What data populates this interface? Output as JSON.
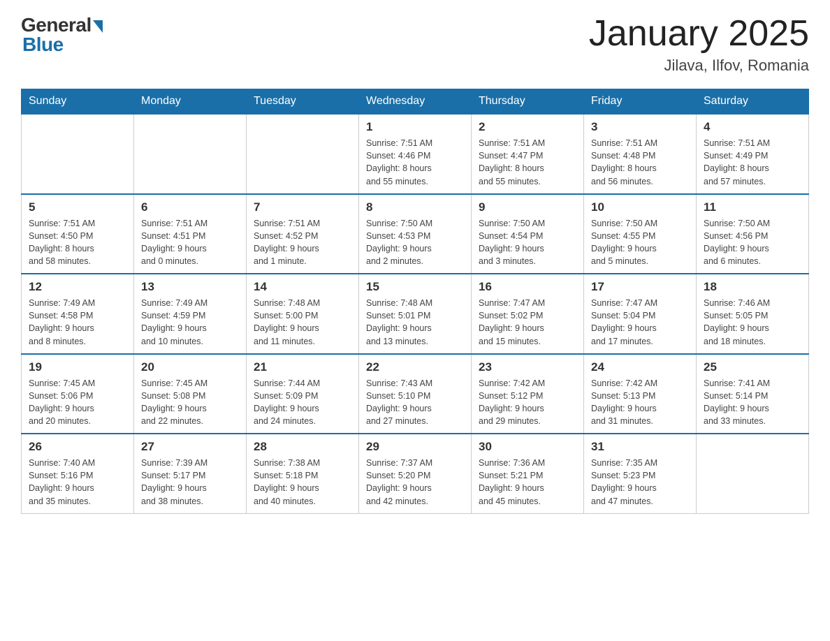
{
  "header": {
    "logo_general": "General",
    "logo_blue": "Blue",
    "title": "January 2025",
    "subtitle": "Jilava, Ilfov, Romania"
  },
  "days_of_week": [
    "Sunday",
    "Monday",
    "Tuesday",
    "Wednesday",
    "Thursday",
    "Friday",
    "Saturday"
  ],
  "weeks": [
    [
      {
        "day": "",
        "info": ""
      },
      {
        "day": "",
        "info": ""
      },
      {
        "day": "",
        "info": ""
      },
      {
        "day": "1",
        "info": "Sunrise: 7:51 AM\nSunset: 4:46 PM\nDaylight: 8 hours\nand 55 minutes."
      },
      {
        "day": "2",
        "info": "Sunrise: 7:51 AM\nSunset: 4:47 PM\nDaylight: 8 hours\nand 55 minutes."
      },
      {
        "day": "3",
        "info": "Sunrise: 7:51 AM\nSunset: 4:48 PM\nDaylight: 8 hours\nand 56 minutes."
      },
      {
        "day": "4",
        "info": "Sunrise: 7:51 AM\nSunset: 4:49 PM\nDaylight: 8 hours\nand 57 minutes."
      }
    ],
    [
      {
        "day": "5",
        "info": "Sunrise: 7:51 AM\nSunset: 4:50 PM\nDaylight: 8 hours\nand 58 minutes."
      },
      {
        "day": "6",
        "info": "Sunrise: 7:51 AM\nSunset: 4:51 PM\nDaylight: 9 hours\nand 0 minutes."
      },
      {
        "day": "7",
        "info": "Sunrise: 7:51 AM\nSunset: 4:52 PM\nDaylight: 9 hours\nand 1 minute."
      },
      {
        "day": "8",
        "info": "Sunrise: 7:50 AM\nSunset: 4:53 PM\nDaylight: 9 hours\nand 2 minutes."
      },
      {
        "day": "9",
        "info": "Sunrise: 7:50 AM\nSunset: 4:54 PM\nDaylight: 9 hours\nand 3 minutes."
      },
      {
        "day": "10",
        "info": "Sunrise: 7:50 AM\nSunset: 4:55 PM\nDaylight: 9 hours\nand 5 minutes."
      },
      {
        "day": "11",
        "info": "Sunrise: 7:50 AM\nSunset: 4:56 PM\nDaylight: 9 hours\nand 6 minutes."
      }
    ],
    [
      {
        "day": "12",
        "info": "Sunrise: 7:49 AM\nSunset: 4:58 PM\nDaylight: 9 hours\nand 8 minutes."
      },
      {
        "day": "13",
        "info": "Sunrise: 7:49 AM\nSunset: 4:59 PM\nDaylight: 9 hours\nand 10 minutes."
      },
      {
        "day": "14",
        "info": "Sunrise: 7:48 AM\nSunset: 5:00 PM\nDaylight: 9 hours\nand 11 minutes."
      },
      {
        "day": "15",
        "info": "Sunrise: 7:48 AM\nSunset: 5:01 PM\nDaylight: 9 hours\nand 13 minutes."
      },
      {
        "day": "16",
        "info": "Sunrise: 7:47 AM\nSunset: 5:02 PM\nDaylight: 9 hours\nand 15 minutes."
      },
      {
        "day": "17",
        "info": "Sunrise: 7:47 AM\nSunset: 5:04 PM\nDaylight: 9 hours\nand 17 minutes."
      },
      {
        "day": "18",
        "info": "Sunrise: 7:46 AM\nSunset: 5:05 PM\nDaylight: 9 hours\nand 18 minutes."
      }
    ],
    [
      {
        "day": "19",
        "info": "Sunrise: 7:45 AM\nSunset: 5:06 PM\nDaylight: 9 hours\nand 20 minutes."
      },
      {
        "day": "20",
        "info": "Sunrise: 7:45 AM\nSunset: 5:08 PM\nDaylight: 9 hours\nand 22 minutes."
      },
      {
        "day": "21",
        "info": "Sunrise: 7:44 AM\nSunset: 5:09 PM\nDaylight: 9 hours\nand 24 minutes."
      },
      {
        "day": "22",
        "info": "Sunrise: 7:43 AM\nSunset: 5:10 PM\nDaylight: 9 hours\nand 27 minutes."
      },
      {
        "day": "23",
        "info": "Sunrise: 7:42 AM\nSunset: 5:12 PM\nDaylight: 9 hours\nand 29 minutes."
      },
      {
        "day": "24",
        "info": "Sunrise: 7:42 AM\nSunset: 5:13 PM\nDaylight: 9 hours\nand 31 minutes."
      },
      {
        "day": "25",
        "info": "Sunrise: 7:41 AM\nSunset: 5:14 PM\nDaylight: 9 hours\nand 33 minutes."
      }
    ],
    [
      {
        "day": "26",
        "info": "Sunrise: 7:40 AM\nSunset: 5:16 PM\nDaylight: 9 hours\nand 35 minutes."
      },
      {
        "day": "27",
        "info": "Sunrise: 7:39 AM\nSunset: 5:17 PM\nDaylight: 9 hours\nand 38 minutes."
      },
      {
        "day": "28",
        "info": "Sunrise: 7:38 AM\nSunset: 5:18 PM\nDaylight: 9 hours\nand 40 minutes."
      },
      {
        "day": "29",
        "info": "Sunrise: 7:37 AM\nSunset: 5:20 PM\nDaylight: 9 hours\nand 42 minutes."
      },
      {
        "day": "30",
        "info": "Sunrise: 7:36 AM\nSunset: 5:21 PM\nDaylight: 9 hours\nand 45 minutes."
      },
      {
        "day": "31",
        "info": "Sunrise: 7:35 AM\nSunset: 5:23 PM\nDaylight: 9 hours\nand 47 minutes."
      },
      {
        "day": "",
        "info": ""
      }
    ]
  ]
}
